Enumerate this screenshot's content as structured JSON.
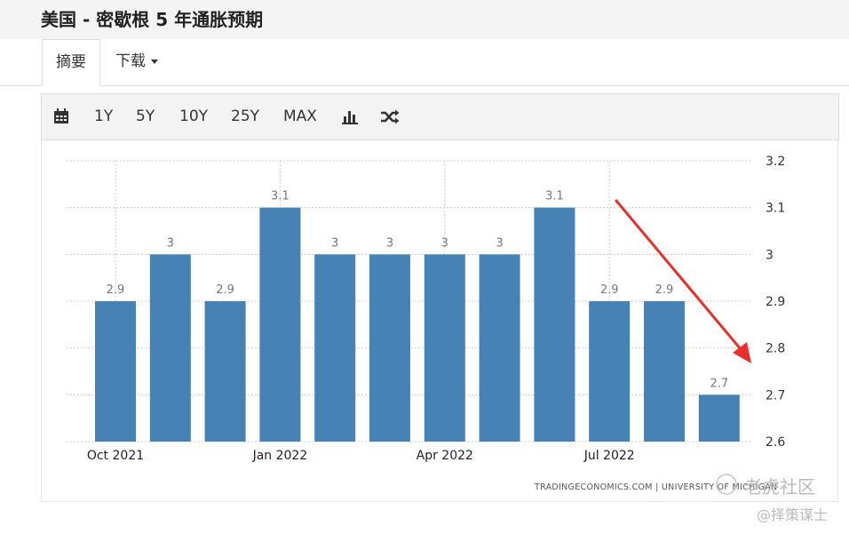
{
  "header": {
    "title": "美国 - 密歇根 5 年通胀预期"
  },
  "tabs": [
    {
      "label": "摘要"
    },
    {
      "label": "下载"
    }
  ],
  "toolbar": {
    "calendar_icon": "calendar-icon",
    "ranges": [
      "1Y",
      "5Y",
      "10Y",
      "25Y",
      "MAX"
    ],
    "chart_type_icon": "bar-chart-icon",
    "compare_icon": "shuffle-icon"
  },
  "chart_data": {
    "type": "bar",
    "categories": [
      "Oct 2021",
      "Nov 2021",
      "Dec 2021",
      "Jan 2022",
      "Feb 2022",
      "Mar 2022",
      "Apr 2022",
      "May 2022",
      "Jun 2022",
      "Jul 2022",
      "Aug 2022",
      "Sep 2022"
    ],
    "values": [
      2.9,
      3,
      2.9,
      3.1,
      3,
      3,
      3,
      3,
      3.1,
      2.9,
      2.9,
      2.7
    ],
    "data_labels": [
      "2.9",
      "3",
      "2.9",
      "3.1",
      "3",
      "3",
      "3",
      "3",
      "3.1",
      "2.9",
      "2.9",
      "2.7"
    ],
    "x_tick_labels": [
      "Oct 2021",
      "",
      "",
      "Jan 2022",
      "",
      "",
      "Apr 2022",
      "",
      "",
      "Jul 2022",
      "",
      ""
    ],
    "y_ticks": [
      "2.6",
      "2.7",
      "2.8",
      "2.9",
      "3",
      "3.1",
      "3.2"
    ],
    "ylim": [
      2.6,
      3.2
    ],
    "y_axis_side": "right",
    "grid": true,
    "bar_color": "#4682b4",
    "annotation": "red-arrow-down",
    "source": "TRADINGECONOMICS.COM  |  UNIVERSITY OF MICHIGAN"
  },
  "watermarks": [
    "老虎社区",
    "@择策谋士"
  ],
  "colors": {
    "bar": "#4682b4",
    "arrow": "#e8302b",
    "grid": "#cccccc"
  }
}
